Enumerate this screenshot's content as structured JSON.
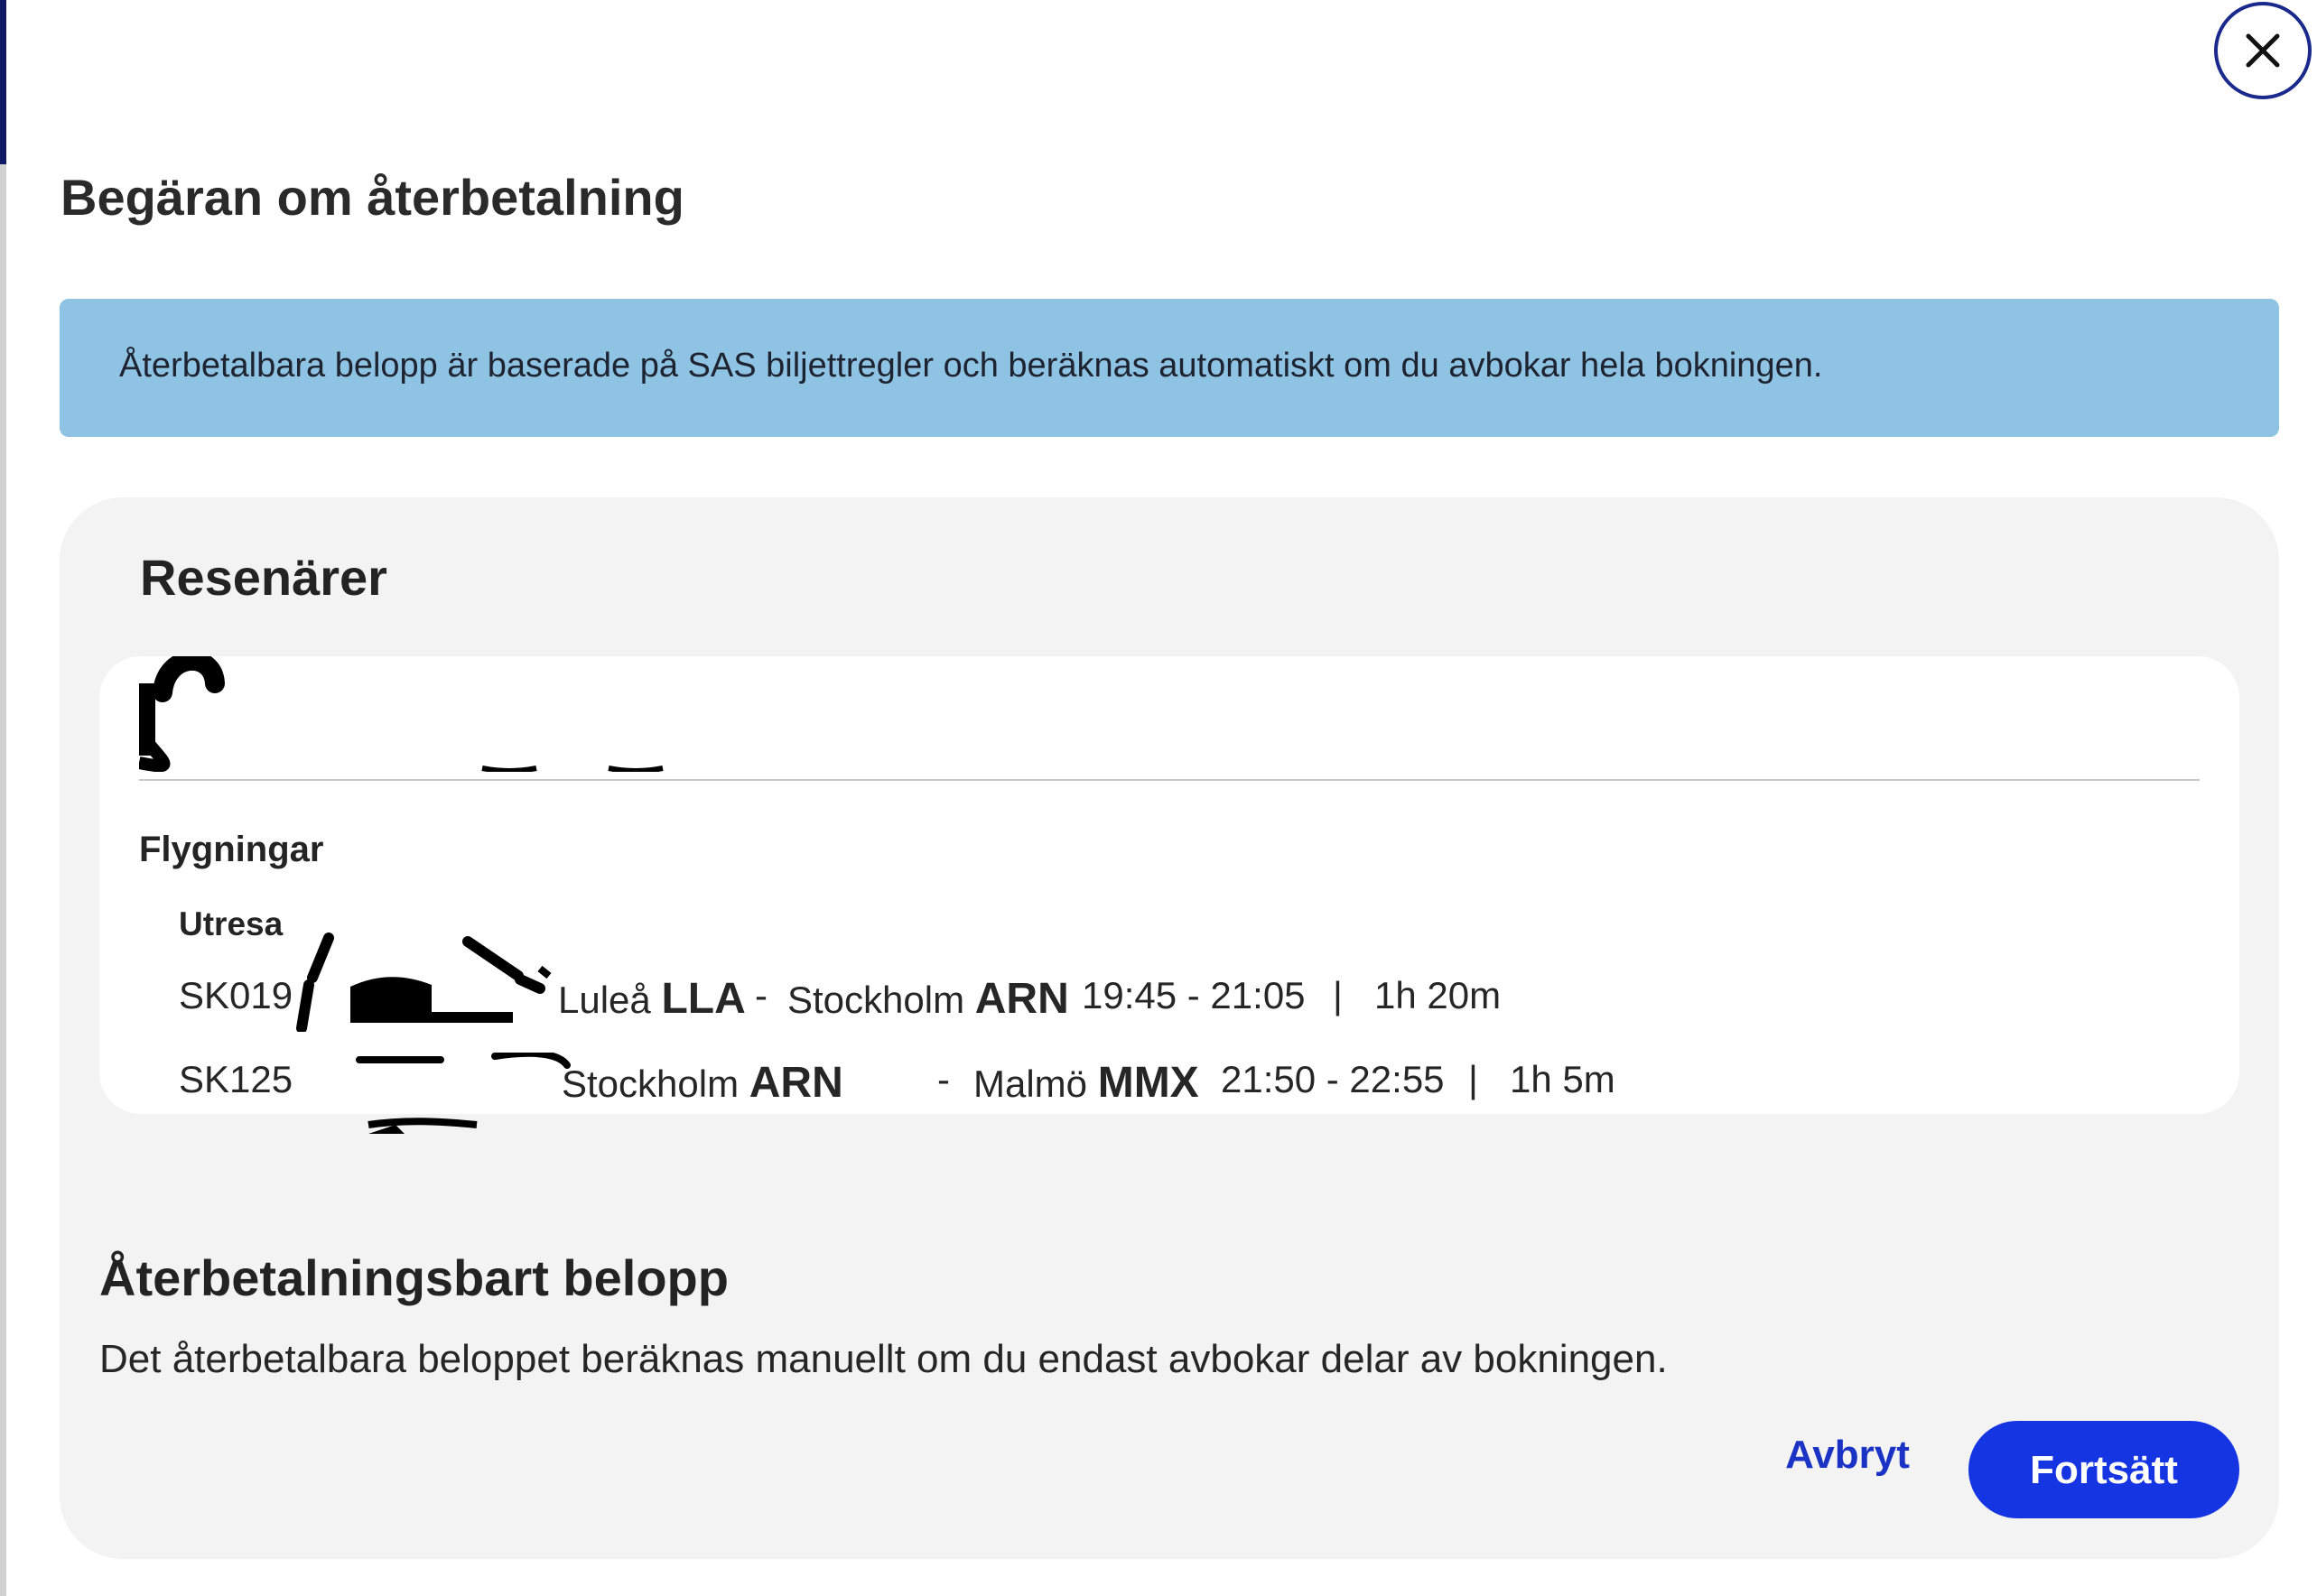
{
  "dialog": {
    "title": "Begäran om återbetalning",
    "close_icon": "close-icon"
  },
  "info_banner": {
    "text": "Återbetalbara belopp är baserade på SAS biljettregler och beräknas automatiskt om du avbokar hela bokningen.",
    "color": "#8ec3e3"
  },
  "passengers": {
    "heading": "Resenärer",
    "flights_heading": "Flygningar",
    "direction_label": "Utresa",
    "flights": [
      {
        "flight_number": "SK019",
        "from_city": "Luleå",
        "from_code": "LLA",
        "separator": "-",
        "to_city": "Stockholm",
        "to_code": "ARN",
        "time": "19:45 - 21:05",
        "pipe": "|",
        "duration": "1h 20m"
      },
      {
        "flight_number": "SK125",
        "from_city": "Stockholm",
        "from_code": "ARN",
        "separator": "-",
        "to_city": "Malmö",
        "to_code": "MMX",
        "time": "21:50 - 22:55",
        "pipe": "|",
        "duration": "1h 5m"
      }
    ]
  },
  "refund": {
    "heading": "Återbetalningsbart belopp",
    "description": "Det återbetalbara beloppet beräknas manuellt om du endast avbokar delar av bokningen."
  },
  "actions": {
    "cancel_label": "Avbryt",
    "continue_label": "Fortsätt",
    "accent_color": "#1535e3"
  }
}
